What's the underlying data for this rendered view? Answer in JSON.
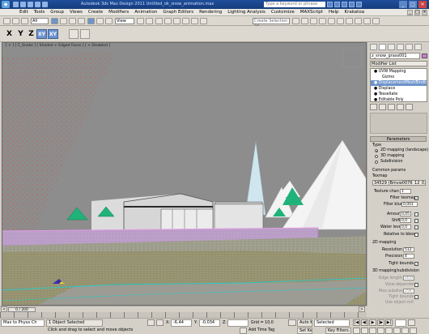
{
  "titlebar": {
    "title": "Autodesk 3ds Max Design 2011   Untitled_ok_snow_animation.max",
    "search_placeholder": "Type a keyword or phrase"
  },
  "menu": [
    "Edit",
    "Tools",
    "Group",
    "Views",
    "Create",
    "Modifiers",
    "Animation",
    "Graph Editors",
    "Rendering",
    "Lighting Analysis",
    "Customize",
    "MAXScript",
    "Help",
    "Krakatoa"
  ],
  "toolbar": {
    "selection_filter": "All",
    "ref_coord": "View",
    "selection_set": "Create Selection Se"
  },
  "axis": {
    "x": "X",
    "y": "Y",
    "z": "Z",
    "xy": "XY",
    "xy2": "XY"
  },
  "viewport": {
    "label": "[ + ] [ C_Snake ] [ Shaded + Edged Faces ] [ + Disabled ]"
  },
  "panel": {
    "object_name": "z_snow_grass001",
    "modifier_list": "Modifier List",
    "stack": [
      {
        "label": "UVW Mapping",
        "selected": false,
        "indent": false
      },
      {
        "label": "Gizmo",
        "selected": false,
        "indent": true
      },
      {
        "label": "DisplacementMeshBinding",
        "selected": true,
        "indent": false
      },
      {
        "label": "Displace",
        "selected": false,
        "indent": false
      },
      {
        "label": "Tessellate",
        "selected": false,
        "indent": false
      },
      {
        "label": "Editable Poly",
        "selected": false,
        "indent": false
      }
    ],
    "rollout_title": "Parameters",
    "type_label": "Type",
    "type_options": [
      "2D mapping (landscape)",
      "3D mapping",
      "Subdivision"
    ],
    "type_selected": 0,
    "common_params": "Common params",
    "texmap_label": "Texmap",
    "texmap_value": "34529 (Bmvw0076_12_0.jpg)",
    "texture_chan_label": "Texture chan",
    "texture_chan_value": "1",
    "filter_texmap": "Filter texmap",
    "filter_blur_label": "Filter blur",
    "filter_blur_value": "0,001",
    "amount_label": "Amount",
    "amount_value": "0,05",
    "shift_label": "Shift",
    "shift_value": "0,0",
    "water_level_label": "Water level",
    "water_level_value": "0,0",
    "relative_to_bbox": "Relative to bbox",
    "mapping_2d": "2D mapping",
    "resolution_label": "Resolution",
    "resolution_value": "512",
    "precision_label": "Precision",
    "precision_value": "4",
    "tight_bounds": "Tight bounds",
    "mapping_3d": "3D mapping/subdivision",
    "edge_len_label": "Edge length",
    "edge_len_value": "20,0",
    "view_dependent": "View-dependent",
    "max_subdiv_label": "Max.subdivs",
    "max_subdiv_value": "256",
    "tight_bounds2": "Tight bounds",
    "use_object_mtl": "Use object mtl",
    "keep_continuity": "Keep continuity"
  },
  "timeline": {
    "slider": "0 / 200"
  },
  "status": {
    "maxscript": "Max to Physx Ch",
    "selected": "1 Object Selected",
    "prompt": "Click and drag to select and move objects",
    "x_label": "X:",
    "x_value": "-6,44",
    "y_label": "Y:",
    "y_value": "-0,034",
    "z_label": "Z:",
    "z_value": "",
    "grid": "Grid = 10,0",
    "add_time_tag": "Add Time Tag",
    "auto_key": "Auto Key",
    "set_key": "Set Key",
    "key_mode": "Selected",
    "key_filters": "Key Filters..."
  },
  "colors": {
    "sky": "#8c8d8c",
    "accent": "#6e94cc",
    "wireframe_red": "#e0474b",
    "wireframe_pink": "#d07ad4",
    "green_tent": "#1fb37a"
  }
}
